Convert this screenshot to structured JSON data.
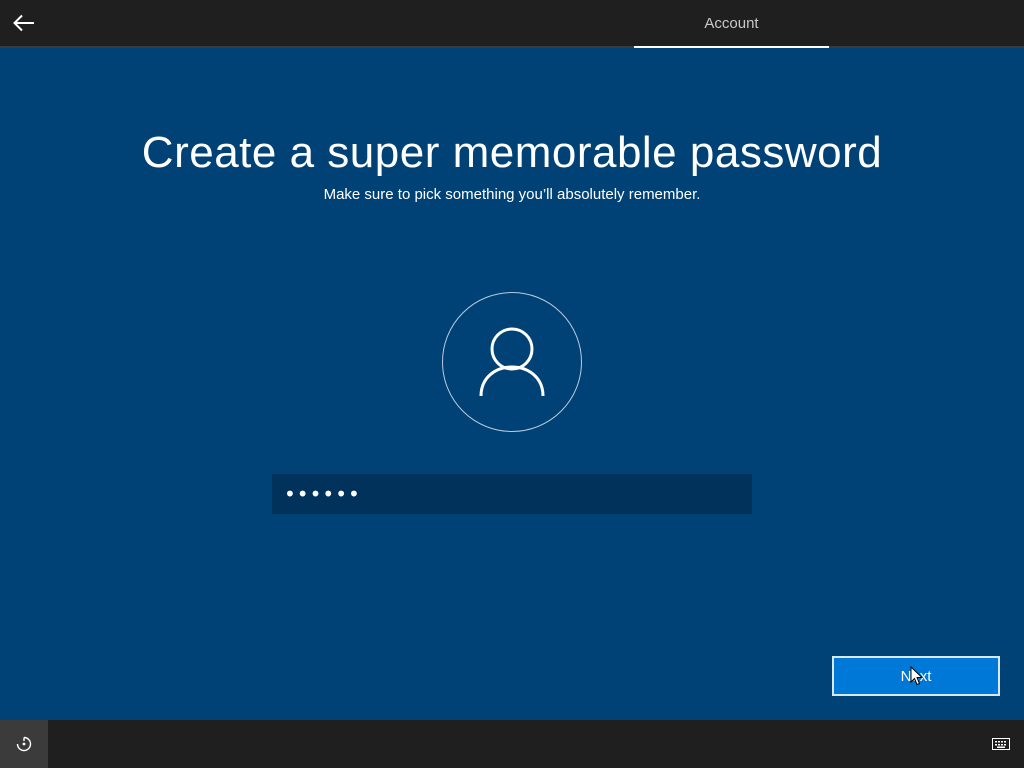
{
  "header": {
    "back_icon": "back-arrow-icon",
    "active_tab": "Account"
  },
  "main": {
    "title": "Create a super memorable password",
    "subtitle": "Make sure to pick something you’ll absolutely remember.",
    "avatar_icon": "user-icon",
    "password": {
      "value": "••••••",
      "placeholder": ""
    }
  },
  "footer": {
    "next_label": "Next",
    "ease_of_access_icon": "ease-of-access-icon",
    "keyboard_icon": "keyboard-icon"
  },
  "colors": {
    "background": "#004275",
    "top_bar": "#1f1f1f",
    "input_background": "#00325b",
    "button_accent": "#0078d7"
  }
}
